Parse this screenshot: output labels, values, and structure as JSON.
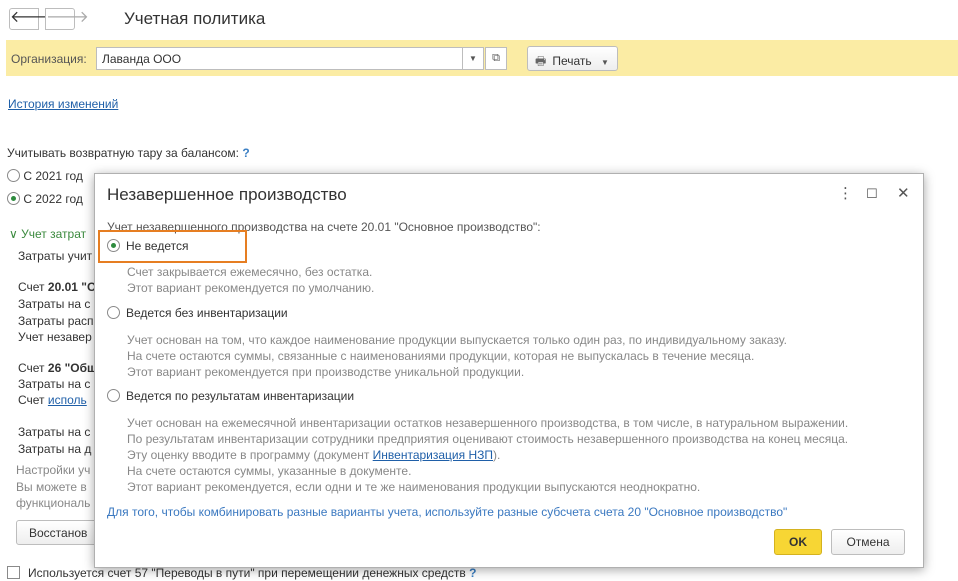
{
  "window": {
    "title": "Учетная политика"
  },
  "nav": {
    "back": "🡐",
    "forward": "🡒"
  },
  "toolbar": {
    "org_label": "Организация:",
    "org_value": "Лаванда ООО",
    "dropdown_glyph": "▼",
    "open_glyph": "⧉",
    "print_label": "Печать",
    "print_icon": "🖶",
    "print_caret": "▼"
  },
  "history_link": "История изменений",
  "background": {
    "returnable_label": "Учитывать возвратную тару за балансом:",
    "help": "?",
    "radio_2021": "С 2021 год",
    "radio_2022": "С 2022 год",
    "costs_section": "Учет затрат",
    "costs_chevron": "∨",
    "lines": [
      "Затраты учит",
      "Затраты на с",
      "Затраты расп",
      "Учет незавер",
      "Затраты на с",
      "Затраты на д"
    ],
    "acc_2001_prefix": "Счет ",
    "acc_2001_bold": "20.01 \"О",
    "acc_26_prefix": "Счет ",
    "acc_26_bold": "26 \"Общ",
    "acc_26_link_prefix": "Счет ",
    "acc_26_link": "исполь",
    "notes": [
      "Настройки уч",
      "Вы можете в",
      "функциональ"
    ],
    "restore_button": "Восстанов",
    "checkbox_label": "Используется счет 57 \"Переводы в пути\" при перемещении денежных средств",
    "checkbox_help": "?"
  },
  "dialog": {
    "title": "Незавершенное производство",
    "more_icon": "⋮",
    "maximize_icon": "☐",
    "close_icon": "✕",
    "intro": "Учет незавершенного производства на счете 20.01 \"Основное производство\":",
    "option1": {
      "label": "Не ведется",
      "desc": [
        "Счет закрывается ежемесячно, без остатка.",
        "Этот вариант рекомендуется по умолчанию."
      ]
    },
    "option2": {
      "label": "Ведется без инвентаризации",
      "desc": [
        "Учет основан на том, что каждое наименование продукции выпускается только один раз, по индивидуальному заказу.",
        "На счете остаются суммы, связанные с наименованиями продукции, которая не выпускалась в течение месяца.",
        "Этот вариант рекомендуется при производстве уникальной продукции."
      ]
    },
    "option3": {
      "label": "Ведется по результатам инвентаризации",
      "desc1": "Учет основан на ежемесячной инвентаризации остатков незавершенного производства, в том числе, в натуральном выражении.",
      "desc2": "По результатам инвентаризации сотрудники предприятия оценивают стоимость незавершенного производства на конец месяца.",
      "desc3_prefix": "Эту оценку вводите в программу (документ ",
      "desc3_link": "Инвентаризация НЗП",
      "desc3_suffix": ").",
      "desc4": "На счете остаются суммы, указанные в документе.",
      "desc5": "Этот вариант рекомендуется, если одни и те же наименования продукции выпускаются неоднократно."
    },
    "footer_link": "Для того, чтобы комбинировать разные варианты учета, используйте разные субсчета счета 20 \"Основное производство\"",
    "ok_button": "OK",
    "cancel_button": "Отмена"
  }
}
